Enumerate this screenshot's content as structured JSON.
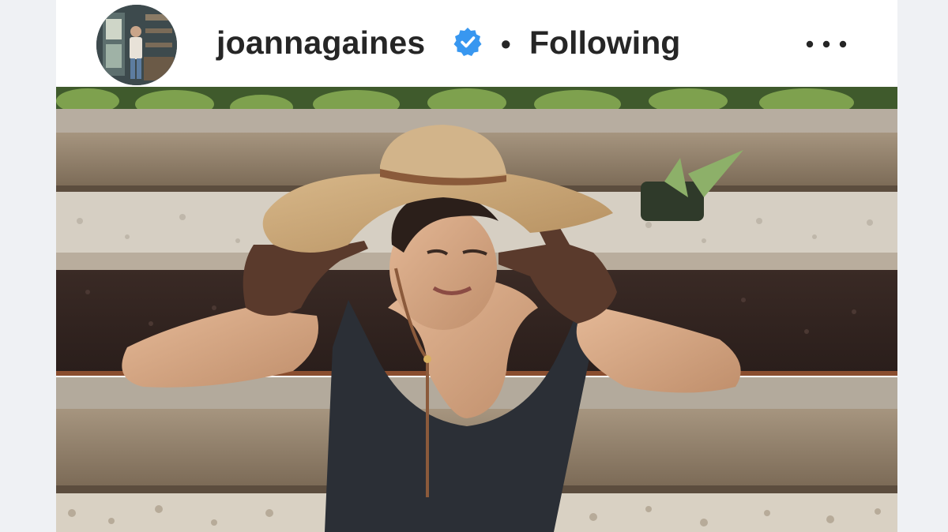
{
  "post": {
    "author": {
      "username": "joannagaines",
      "verified": true,
      "avatar_icon": "profile-photo",
      "separator": "•",
      "follow_status": "Following"
    },
    "menu_icon": "more-options-icon",
    "photo_description_icon": "garden-photo"
  },
  "colors": {
    "text": "#262626",
    "verified_badge": "#3897f0",
    "page_background": "#eff1f4"
  }
}
